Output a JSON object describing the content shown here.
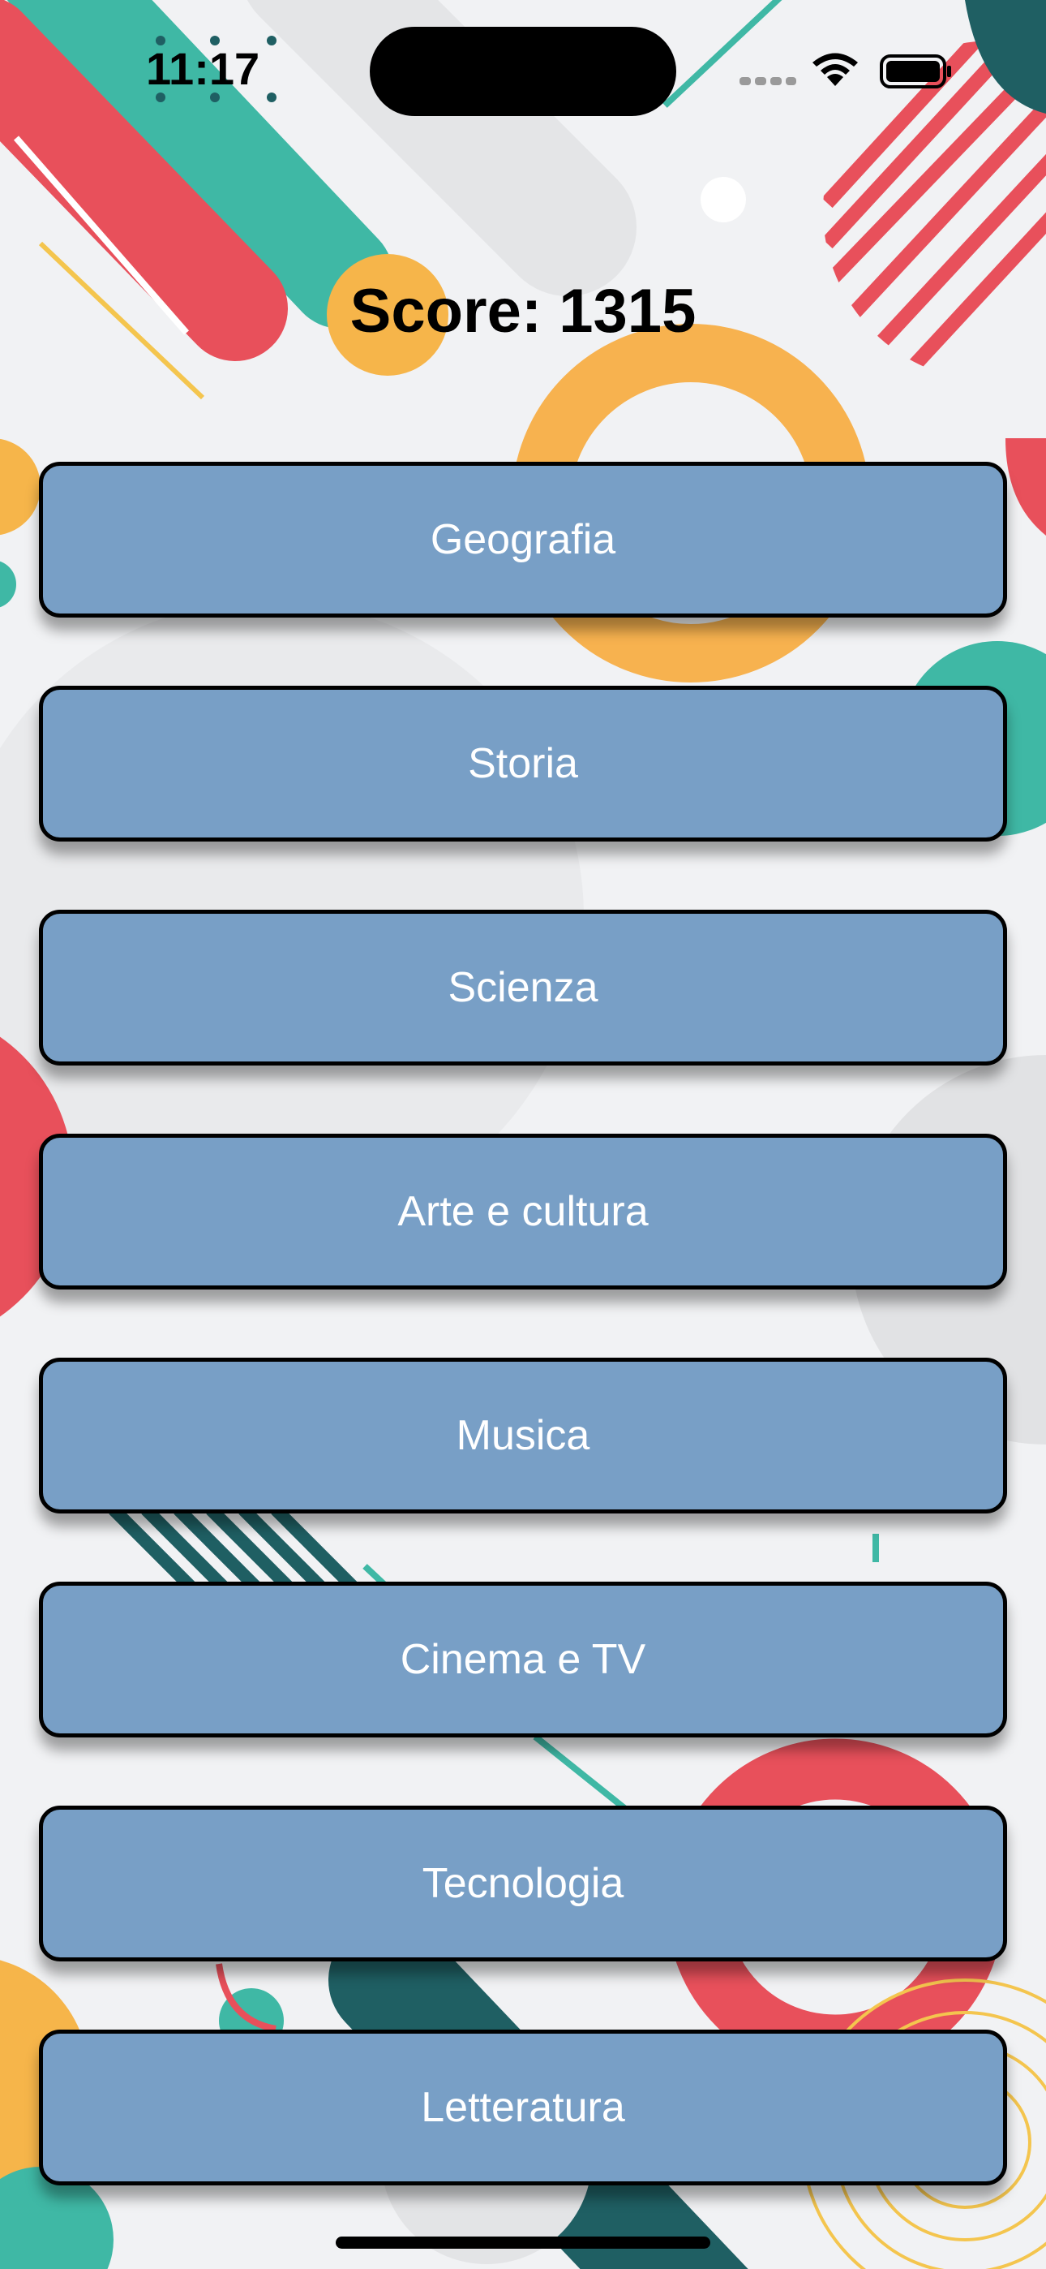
{
  "status_bar": {
    "time": "11:17"
  },
  "score_text": "Score: 1315",
  "categories": [
    {
      "label": "Geografia"
    },
    {
      "label": "Storia"
    },
    {
      "label": "Scienza"
    },
    {
      "label": "Arte e cultura"
    },
    {
      "label": "Musica"
    },
    {
      "label": "Cinema e TV"
    },
    {
      "label": "Tecnologia"
    },
    {
      "label": "Letteratura"
    }
  ],
  "colors": {
    "button_fill": "#789fc6",
    "button_border": "#000000",
    "button_text": "#ffffff",
    "background": "#f1f2f4"
  }
}
